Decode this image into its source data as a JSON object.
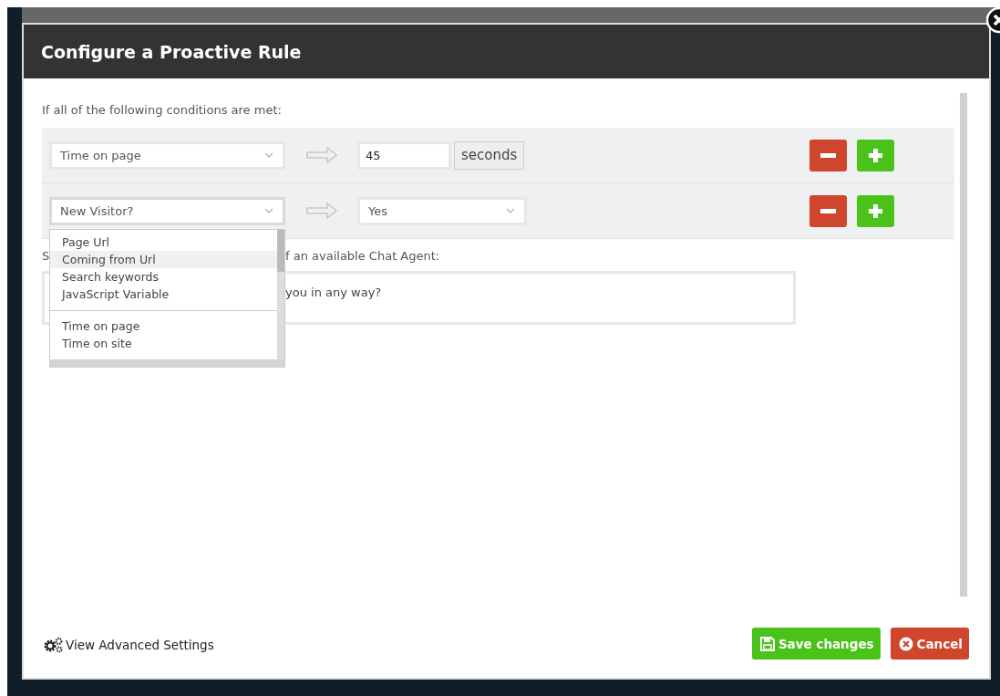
{
  "dialog": {
    "title": "Configure a Proactive Rule"
  },
  "conditions_label": "If all of the following conditions are met:",
  "conditions": [
    {
      "kind": "number",
      "field": "Time on page",
      "value": "45",
      "unit": "seconds",
      "expanded": false
    },
    {
      "kind": "select",
      "field": "New Visitor?",
      "value": "Yes",
      "expanded": true
    }
  ],
  "field_options": [
    {
      "label": "Page Url",
      "selected": false
    },
    {
      "label": "Coming from Url",
      "selected": true
    },
    {
      "label": "Search keywords",
      "selected": false
    },
    {
      "label": "JavaScript Variable",
      "selected": false
    },
    {
      "kind": "separator"
    },
    {
      "label": "Time on page",
      "selected": false
    },
    {
      "label": "Time on site",
      "selected": false
    }
  ],
  "message_label": [
    "S",
    "f an available Chat Agent:"
  ],
  "message_value": "you in any way?",
  "footer": {
    "advanced_link": "View Advanced Settings",
    "save_button": "Save changes",
    "cancel_button": "Cancel"
  }
}
